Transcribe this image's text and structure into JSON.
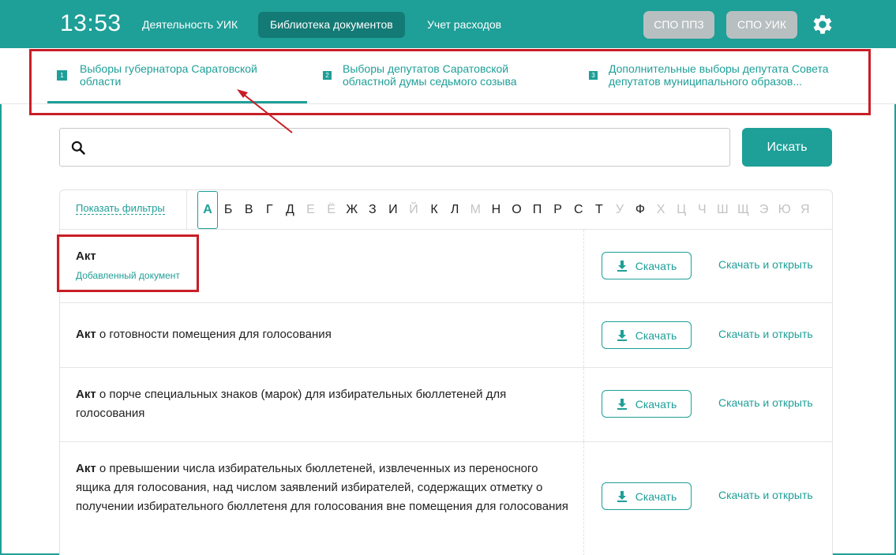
{
  "header": {
    "time": "13:53",
    "nav": [
      {
        "label": "Деятельность УИК"
      },
      {
        "label": "Библиотека документов",
        "active": true
      },
      {
        "label": "Учет расходов"
      }
    ],
    "pills": [
      "СПО ППЗ",
      "СПО УИК"
    ],
    "settings_icon": "gear-icon",
    "accent_color": "#1e9f98"
  },
  "election_tabs": [
    {
      "num": "1",
      "label_line1": "Выборы губернатора Саратовской",
      "label_line2": "области",
      "active": true
    },
    {
      "num": "2",
      "label_line1": "Выборы депутатов Саратовской",
      "label_line2": "областной думы седьмого созыва"
    },
    {
      "num": "3",
      "label_line1": "Дополнительные выборы депутата Совета",
      "label_line2": "депутатов муниципального образов..."
    }
  ],
  "search": {
    "value": "",
    "placeholder": "",
    "button_label": "Искать",
    "icon": "search-icon"
  },
  "filters": {
    "show_filters_label": "Показать фильтры",
    "selected_letter": "А",
    "letters": [
      {
        "c": "А",
        "on": true
      },
      {
        "c": "Б",
        "on": true
      },
      {
        "c": "В",
        "on": true
      },
      {
        "c": "Г",
        "on": true
      },
      {
        "c": "Д",
        "on": true
      },
      {
        "c": "Е",
        "on": false
      },
      {
        "c": "Ё",
        "on": false
      },
      {
        "c": "Ж",
        "on": true
      },
      {
        "c": "З",
        "on": true
      },
      {
        "c": "И",
        "on": true
      },
      {
        "c": "Й",
        "on": false
      },
      {
        "c": "К",
        "on": true
      },
      {
        "c": "Л",
        "on": true
      },
      {
        "c": "М",
        "on": false
      },
      {
        "c": "Н",
        "on": true
      },
      {
        "c": "О",
        "on": true
      },
      {
        "c": "П",
        "on": true
      },
      {
        "c": "Р",
        "on": true
      },
      {
        "c": "С",
        "on": true
      },
      {
        "c": "Т",
        "on": true
      },
      {
        "c": "У",
        "on": false
      },
      {
        "c": "Ф",
        "on": true
      },
      {
        "c": "Х",
        "on": false
      },
      {
        "c": "Ц",
        "on": false
      },
      {
        "c": "Ч",
        "on": false
      },
      {
        "c": "Ш",
        "on": false
      },
      {
        "c": "Щ",
        "on": false
      },
      {
        "c": "Э",
        "on": false
      },
      {
        "c": "Ю",
        "on": false
      },
      {
        "c": "Я",
        "on": false
      }
    ]
  },
  "documents": [
    {
      "bold": "Акт",
      "rest": "",
      "subtitle": "Добавленный документ"
    },
    {
      "bold": "Акт",
      "rest": " о готовности помещения для голосования"
    },
    {
      "bold": "Акт",
      "rest": " о порче специальных знаков (марок) для избирательных бюллетеней для голосования"
    },
    {
      "bold": "Акт",
      "rest": " о превышении числа избирательных бюллетеней, извлеченных из переносного ящика для голосования, над числом заявлений избирателей, содержащих отметку о получении избирательного бюллетеня для голосования вне помещения для голосования"
    }
  ],
  "actions": {
    "download_label": "Скачать",
    "download_open_label": "Скачать и открыть",
    "download_icon": "download-icon"
  },
  "annotation_color": "#c81e26"
}
